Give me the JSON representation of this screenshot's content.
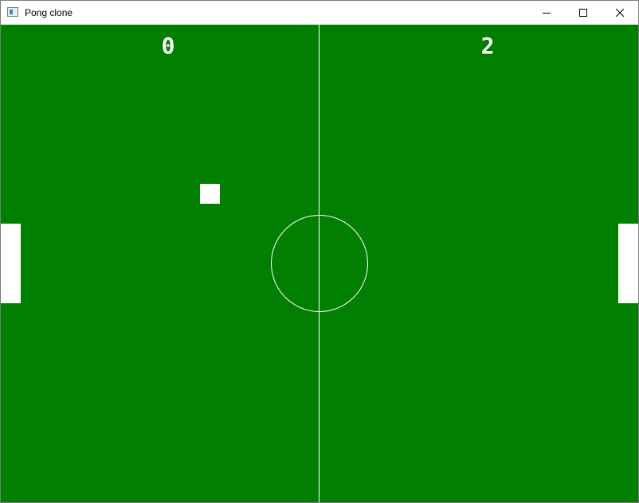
{
  "window": {
    "title": "Pong clone",
    "icon": "app-window-icon",
    "controls": {
      "minimize_icon": "minimize-icon",
      "maximize_icon": "maximize-icon",
      "close_icon": "close-icon"
    }
  },
  "game": {
    "field_color": "#007f00",
    "line_color": "#ffffff",
    "score_left": "0",
    "score_right": "2"
  }
}
